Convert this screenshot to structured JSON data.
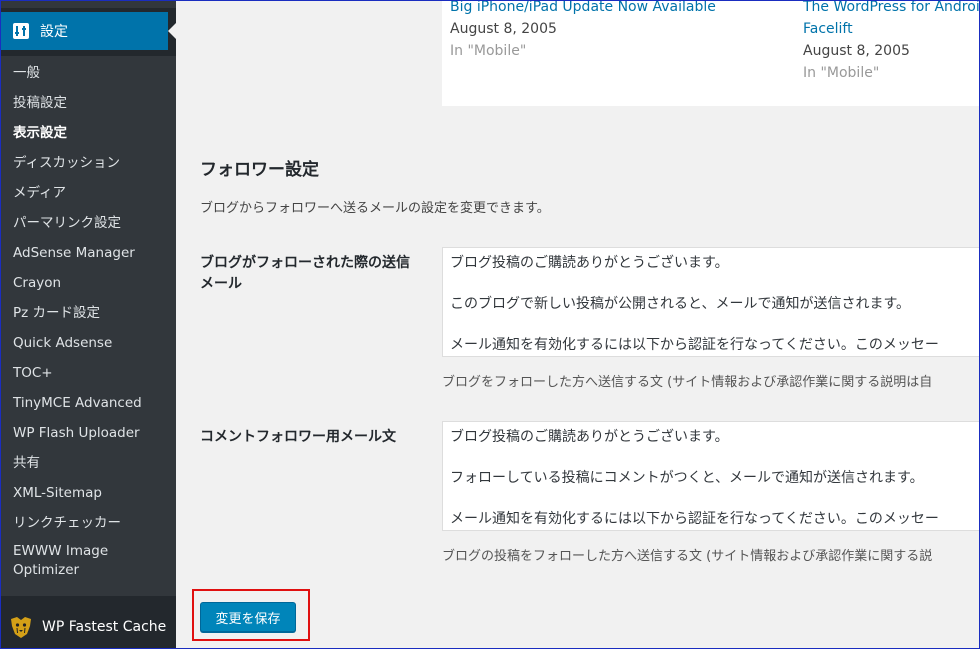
{
  "sidebar": {
    "current_menu": "設定",
    "submenu": [
      "一般",
      "投稿設定",
      "表示設定",
      "ディスカッション",
      "メディア",
      "パーマリンク設定",
      "AdSense Manager",
      "Crayon",
      "Pz カード設定",
      "Quick Adsense",
      "TOC+",
      "TinyMCE Advanced",
      "WP Flash Uploader",
      "共有",
      "XML-Sitemap",
      "リンクチェッカー",
      "EWWW Image Optimizer"
    ],
    "current_index": 2,
    "fastest_cache": "WP Fastest Cache"
  },
  "preview": {
    "posts": [
      {
        "title": "Big iPhone/iPad Update Now Available",
        "date": "August 8, 2005",
        "category": "In \"Mobile\""
      },
      {
        "title_line1": "The WordPress for Androi",
        "title_line2": "Facelift",
        "date": "August 8, 2005",
        "category": "In \"Mobile\""
      }
    ]
  },
  "follower": {
    "title": "フォロワー設定",
    "description": "ブログからフォロワーへ送るメールの設定を変更できます。",
    "blog_follow": {
      "label": "ブログがフォローされた際の送信メール",
      "lines": [
        "ブログ投稿のご購読ありがとうございます。",
        "このブログで新しい投稿が公開されると、メールで通知が送信されます。",
        "メール通知を有効化するには以下から認証を行なってください。このメッセー"
      ],
      "help": "ブログをフォローした方へ送信する文 (サイト情報および承認作業に関する説明は自"
    },
    "comment_follow": {
      "label": "コメントフォロワー用メール文",
      "lines": [
        "ブログ投稿のご購読ありがとうございます。",
        "フォローしている投稿にコメントがつくと、メールで通知が送信されます。",
        "メール通知を有効化するには以下から認証を行なってください。このメッセー"
      ],
      "help": "ブログの投稿をフォローした方へ送信する文 (サイト情報および承認作業に関する説"
    }
  },
  "save_button": "変更を保存",
  "colors": {
    "accent": "#0073aa",
    "highlight": "#e01010"
  }
}
